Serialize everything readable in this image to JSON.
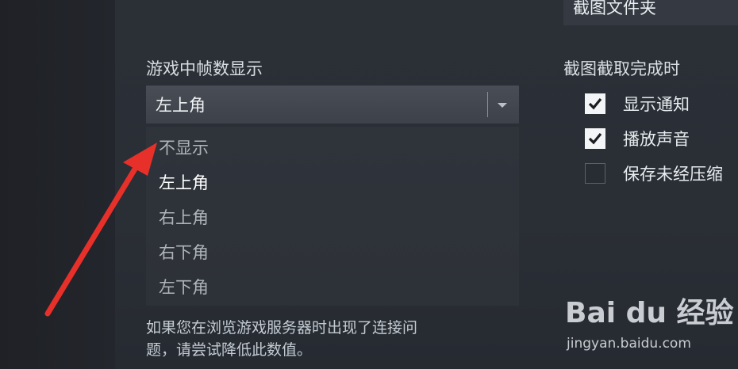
{
  "top_field": {
    "label": "截图文件夹"
  },
  "fps_section": {
    "label": "游戏中帧数显示",
    "select_value": "左上角",
    "options": [
      {
        "label": "不显示",
        "selected": false
      },
      {
        "label": "左上角",
        "selected": true
      },
      {
        "label": "右上角",
        "selected": false
      },
      {
        "label": "右下角",
        "selected": false
      },
      {
        "label": "左下角",
        "selected": false
      }
    ],
    "hint_line1": "如果您在浏览游戏服务器时出现了连接问",
    "hint_line2": "题，请尝试降低此数值。"
  },
  "screenshot_section": {
    "label": "截图截取完成时",
    "checkboxes": [
      {
        "label": "显示通知",
        "checked": true
      },
      {
        "label": "播放声音",
        "checked": true
      },
      {
        "label": "保存未经压缩",
        "checked": false
      }
    ]
  },
  "watermark": {
    "brand": "Bai du 经验",
    "url": "jingyan.baidu.com"
  },
  "colors": {
    "annotation_arrow": "#e8302a",
    "checkbox_on": "#f4f5f6"
  },
  "icons": {
    "select_arrow": "chevron-down-icon",
    "check": "check-icon",
    "annotation": "red-arrow-icon"
  }
}
